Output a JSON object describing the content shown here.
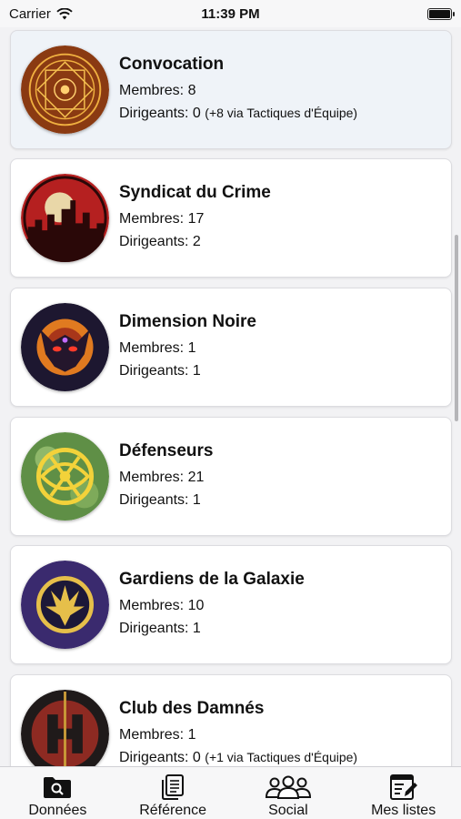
{
  "status": {
    "carrier": "Carrier",
    "time": "11:39 PM"
  },
  "teams": [
    {
      "name": "Convocation",
      "members": "Membres: 8",
      "leaders": "Dirigeants: 0",
      "leaders_extra": "(+8 via Tactiques d'Équipe)",
      "emblem": "mystic-seal",
      "selected": true
    },
    {
      "name": "Syndicat du Crime",
      "members": "Membres: 17",
      "leaders": "Dirigeants: 2",
      "leaders_extra": "",
      "emblem": "city-skyline"
    },
    {
      "name": "Dimension Noire",
      "members": "Membres: 1",
      "leaders": "Dirigeants: 1",
      "leaders_extra": "",
      "emblem": "dark-demon"
    },
    {
      "name": "Défenseurs",
      "members": "Membres: 21",
      "leaders": "Dirigeants: 1",
      "leaders_extra": "",
      "emblem": "eye-of-agamotto"
    },
    {
      "name": "Gardiens de la Galaxie",
      "members": "Membres: 10",
      "leaders": "Dirigeants: 1",
      "leaders_extra": "",
      "emblem": "guardians-badge"
    },
    {
      "name": "Club des Damnés",
      "members": "Membres: 1",
      "leaders": "Dirigeants: 0",
      "leaders_extra": "(+1 via Tactiques d'Équipe)",
      "emblem": "hellfire-h"
    }
  ],
  "tabs": [
    {
      "label": "Données",
      "icon": "folder-search-icon"
    },
    {
      "label": "Référence",
      "icon": "document-icon"
    },
    {
      "label": "Social",
      "icon": "people-icon"
    },
    {
      "label": "Mes listes",
      "icon": "list-edit-icon"
    }
  ]
}
